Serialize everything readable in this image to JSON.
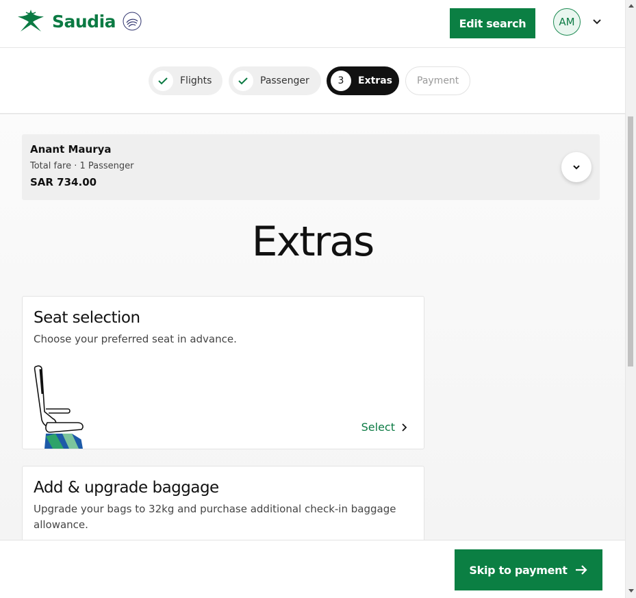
{
  "header": {
    "brand": "Saudia",
    "edit_search_label": "Edit search",
    "avatar_initials": "AM"
  },
  "stepper": {
    "steps": [
      {
        "label": "Flights",
        "state": "done"
      },
      {
        "label": "Passenger",
        "state": "done"
      },
      {
        "label": "Extras",
        "state": "active",
        "number": "3"
      },
      {
        "label": "Payment",
        "state": "pending"
      }
    ]
  },
  "fare": {
    "name": "Anant Maurya",
    "subtitle": "Total fare · 1 Passenger",
    "amount": "SAR 734.00"
  },
  "page": {
    "title": "Extras"
  },
  "extras": {
    "seat": {
      "title": "Seat selection",
      "description": "Choose your preferred seat in advance.",
      "action_label": "Select"
    },
    "baggage": {
      "title": "Add & upgrade baggage",
      "description": "Upgrade your bags to 32kg and purchase additional check-in baggage allowance."
    }
  },
  "footer": {
    "skip_label": "Skip to payment"
  },
  "colors": {
    "brand_green": "#0b7f43",
    "active_step": "#111111"
  }
}
